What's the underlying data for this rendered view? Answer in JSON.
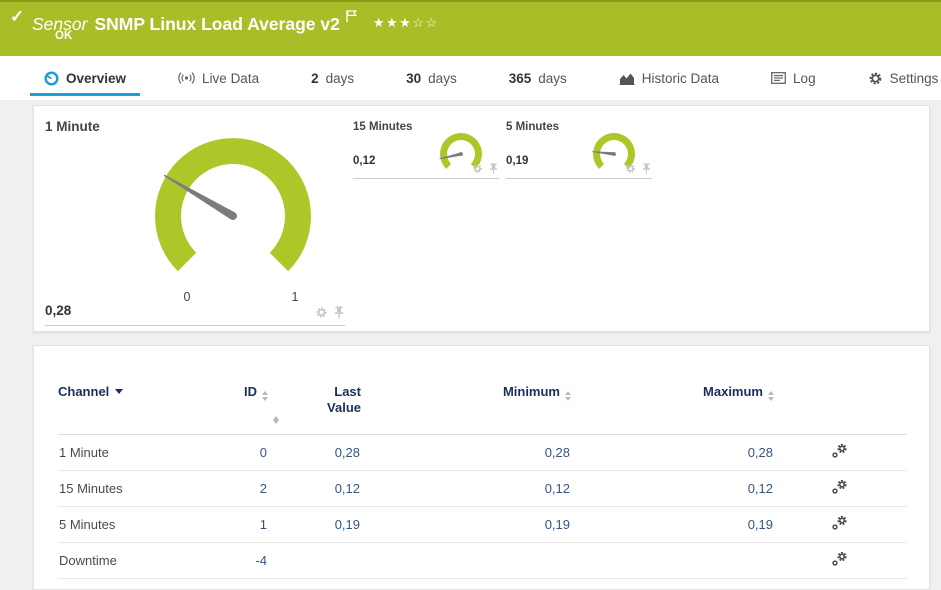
{
  "header": {
    "check_icon": "✓",
    "kind": "Sensor",
    "title": "SNMP Linux Load Average v2",
    "status": "OK",
    "stars": "★★★☆☆",
    "bg_color": "#a9bd28"
  },
  "tabs": [
    {
      "label": "Overview"
    },
    {
      "label": "Live Data"
    },
    {
      "num": "2",
      "label": "days"
    },
    {
      "num": "30",
      "label": "days"
    },
    {
      "num": "365",
      "label": "days"
    },
    {
      "label": "Historic Data"
    },
    {
      "label": "Log"
    },
    {
      "label": "Settings"
    }
  ],
  "gauges": {
    "primary": {
      "title": "1 Minute",
      "value": "0,28",
      "value_num": 0.28,
      "scale_min": "0",
      "scale_max": "1"
    },
    "gauge15": {
      "title": "15 Minutes",
      "value": "0,12",
      "value_num": 0.12
    },
    "gauge5": {
      "title": "5 Minutes",
      "value": "0,19",
      "value_num": 0.19
    }
  },
  "table": {
    "headers": {
      "channel": "Channel",
      "id": "ID",
      "last_line1": "Last",
      "last_line2": "Value",
      "min": "Minimum",
      "max": "Maximum"
    },
    "rows": [
      {
        "channel": "1 Minute",
        "id": "0",
        "last": "0,28",
        "min": "0,28",
        "max": "0,28"
      },
      {
        "channel": "15 Minutes",
        "id": "2",
        "last": "0,12",
        "min": "0,12",
        "max": "0,12"
      },
      {
        "channel": "5 Minutes",
        "id": "1",
        "last": "0,19",
        "min": "0,19",
        "max": "0,19"
      },
      {
        "channel": "Downtime",
        "id": "-4",
        "last": "",
        "min": "",
        "max": ""
      }
    ]
  },
  "colors": {
    "accent_green": "#aec627",
    "accent_blue": "#1b9dd9",
    "navy": "#1b2e5e",
    "needle_gray": "#7c7c7c"
  }
}
